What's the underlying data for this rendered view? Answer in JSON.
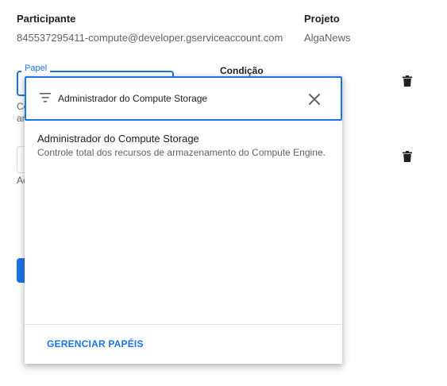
{
  "header": {
    "participant_label": "Participante",
    "participant_value": "845537295411-compute@developer.gserviceaccount.com",
    "project_label": "Projeto",
    "project_value": "AlgaNews"
  },
  "role_field": {
    "label": "Papel",
    "condition_label": "Condição",
    "hint_line1": "Co",
    "hint_line2": "ar",
    "hint_line3": "Ac"
  },
  "dropdown": {
    "filter_value": "Administrador do Compute Storage",
    "options": [
      {
        "title": "Administrador do Compute Storage",
        "description": "Controle total dos recursos de armazenamento do Compute Engine."
      }
    ],
    "manage_roles_label": "GERENCIAR PAPÉIS"
  },
  "icons": {
    "filter": "filter-list-icon",
    "clear": "close-icon",
    "delete": "trash-icon"
  },
  "colors": {
    "accent": "#1a73e8",
    "text": "#202124",
    "secondary_text": "#5f6368"
  }
}
